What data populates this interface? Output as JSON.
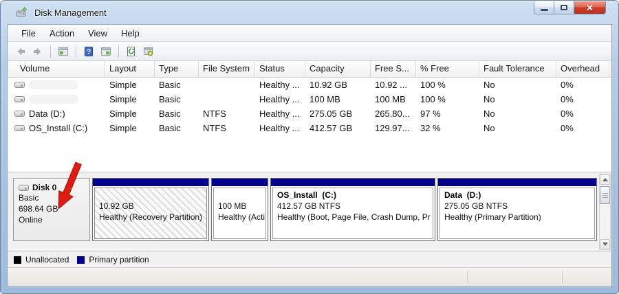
{
  "window": {
    "title": "Disk Management",
    "controls": {
      "minimize": "minimize",
      "maximize": "maximize",
      "close": "close"
    }
  },
  "menu": {
    "items": [
      {
        "label": "File"
      },
      {
        "label": "Action"
      },
      {
        "label": "View"
      },
      {
        "label": "Help"
      }
    ]
  },
  "toolbar": {
    "icons": [
      "back",
      "forward",
      "show-console-tree",
      "help",
      "show-action-pane",
      "refresh",
      "disk-properties"
    ]
  },
  "volume_table": {
    "columns": [
      {
        "label": "Volume"
      },
      {
        "label": "Layout"
      },
      {
        "label": "Type"
      },
      {
        "label": "File System"
      },
      {
        "label": "Status"
      },
      {
        "label": "Capacity"
      },
      {
        "label": "Free S..."
      },
      {
        "label": "% Free"
      },
      {
        "label": "Fault Tolerance"
      },
      {
        "label": "Overhead"
      }
    ],
    "rows": [
      {
        "volume": "",
        "redacted": true,
        "layout": "Simple",
        "type": "Basic",
        "file_system": "",
        "status": "Healthy ...",
        "capacity": "10.92 GB",
        "free_space": "10.92 ...",
        "pct_free": "100 %",
        "fault_tolerance": "No",
        "overhead": "0%"
      },
      {
        "volume": "",
        "redacted": true,
        "layout": "Simple",
        "type": "Basic",
        "file_system": "",
        "status": "Healthy ...",
        "capacity": "100 MB",
        "free_space": "100 MB",
        "pct_free": "100 %",
        "fault_tolerance": "No",
        "overhead": "0%"
      },
      {
        "volume": "Data (D:)",
        "redacted": false,
        "layout": "Simple",
        "type": "Basic",
        "file_system": "NTFS",
        "status": "Healthy ...",
        "capacity": "275.05 GB",
        "free_space": "265.80...",
        "pct_free": "97 %",
        "fault_tolerance": "No",
        "overhead": "0%"
      },
      {
        "volume": "OS_Install (C:)",
        "redacted": false,
        "layout": "Simple",
        "type": "Basic",
        "file_system": "NTFS",
        "status": "Healthy ...",
        "capacity": "412.57 GB",
        "free_space": "129.97...",
        "pct_free": "32 %",
        "fault_tolerance": "No",
        "overhead": "0%"
      }
    ]
  },
  "disk_panel": {
    "disk": {
      "name": "Disk 0",
      "type": "Basic",
      "size": "698.64 GB",
      "status": "Online"
    },
    "partitions": [
      {
        "line1": "10.92 GB",
        "line2": "Healthy (Recovery Partition)",
        "style": "hatched"
      },
      {
        "line1": "100 MB",
        "line2": "Healthy (Acti",
        "style": "plain"
      },
      {
        "title": "OS_Install  (C:)",
        "line1": "412.57 GB NTFS",
        "line2": "Healthy (Boot, Page File, Crash Dump, Pr",
        "style": "plain"
      },
      {
        "title": "Data  (D:)",
        "line1": "275.05 GB NTFS",
        "line2": "Healthy (Primary Partition)",
        "style": "plain"
      }
    ]
  },
  "legend": {
    "items": [
      {
        "label": "Unallocated",
        "color": "#000000"
      },
      {
        "label": "Primary partition",
        "color": "#00008b"
      }
    ]
  },
  "annotation": {
    "type": "red-arrow",
    "points_at": "disk-0-info",
    "color": "#e01b10"
  },
  "colors": {
    "partition_bar": "#00008b",
    "close_button": "#c0392b",
    "frame": "#a8c2e0"
  }
}
